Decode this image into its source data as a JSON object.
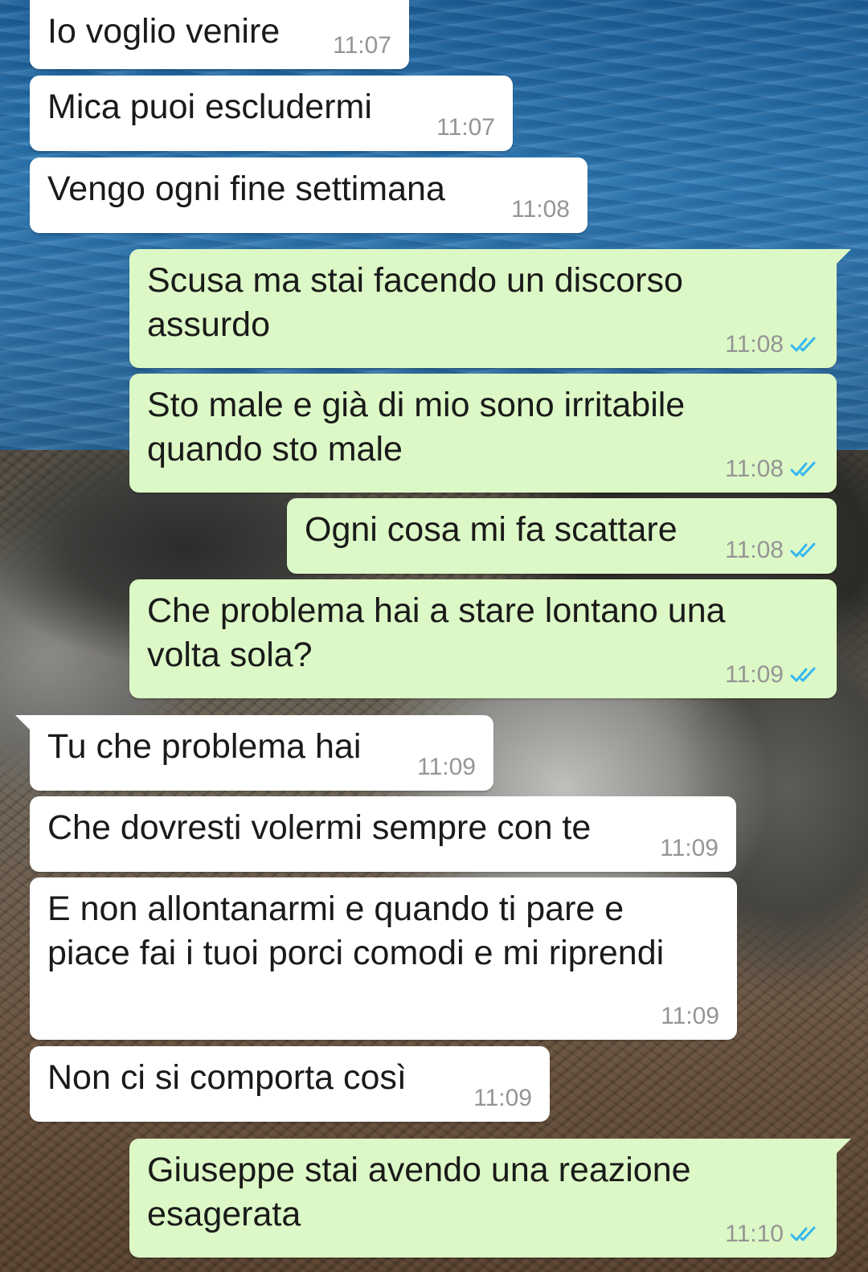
{
  "chat": {
    "messages": [
      {
        "direction": "in",
        "text": "Io voglio venire",
        "time": "11:07"
      },
      {
        "direction": "in",
        "text": "Mica puoi escludermi",
        "time": "11:07"
      },
      {
        "direction": "in",
        "text": "Vengo ogni fine settimana",
        "time": "11:08"
      },
      {
        "direction": "out",
        "text": "Scusa ma stai facendo un discorso\nassurdo",
        "time": "11:08",
        "status": "read-double-check-icon"
      },
      {
        "direction": "out",
        "text": "Sto male e già di mio sono irritabile\nquando sto male",
        "time": "11:08",
        "status": "read-double-check-icon"
      },
      {
        "direction": "out",
        "text": "Ogni cosa mi fa scattare",
        "time": "11:08",
        "status": "read-double-check-icon"
      },
      {
        "direction": "out",
        "text": "Che problema hai a stare lontano una\nvolta sola?",
        "time": "11:09",
        "status": "read-double-check-icon"
      },
      {
        "direction": "in",
        "text": "Tu che problema hai",
        "time": "11:09"
      },
      {
        "direction": "in",
        "text": "Che dovresti volermi sempre con te",
        "time": "11:09"
      },
      {
        "direction": "in",
        "text": "E non allontanarmi e quando ti pare e\npiace fai i tuoi porci comodi e mi riprendi",
        "time": "11:09"
      },
      {
        "direction": "in",
        "text": "Non ci si comporta così",
        "time": "11:09"
      },
      {
        "direction": "out",
        "text": "Giuseppe stai avendo una reazione\nesagerata",
        "time": "11:10",
        "status": "read-double-check-icon"
      }
    ]
  },
  "colors": {
    "incoming_bubble": "#ffffff",
    "outgoing_bubble": "#dcf8c6",
    "read_ticks": "#34b7f1",
    "timestamp": "#959595"
  }
}
